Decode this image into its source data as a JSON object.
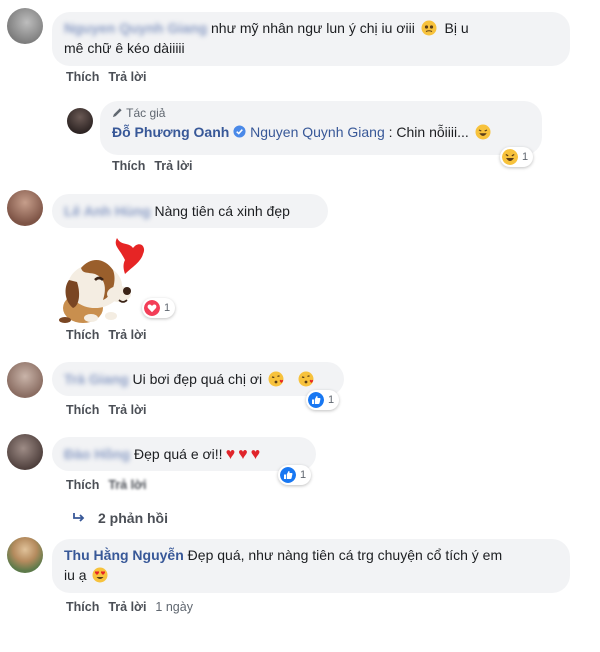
{
  "actions": {
    "like": "Thích",
    "reply": "Trả lời"
  },
  "comments": {
    "c1": {
      "name": "Nguyen Quynh Giang",
      "text": "như mỹ nhân ngư lun ý chị iu ơiii",
      "text2": "Bị u",
      "text3": "mê chữ ê kéo dàiiiii"
    },
    "c2": {
      "badge": "Tác giả",
      "name": "Đỗ Phương Oanh",
      "tag": "Nguyen Quynh Giang",
      "text": ": Chin nỗiiii...",
      "reaction_count": "1"
    },
    "c3": {
      "name": "Lê Anh Hùng",
      "text": "Nàng tiên cá xinh đẹp",
      "reaction_count": "1"
    },
    "c4": {
      "name": "Trà Giang",
      "text": "Ui bơi đẹp quá chị ơi",
      "reaction_count": "1"
    },
    "c5": {
      "name": "Đào Hồng",
      "text": "Đẹp quá e ơi!!",
      "reaction_count": "1"
    },
    "c6": {
      "name": "Thu Hằng Nguyễn",
      "text": "Đẹp quá, như nàng tiên cá trg chuyện cổ tích ý em",
      "text2": "iu ạ",
      "time": "1 ngày"
    }
  },
  "replies_link": "2 phản hồi",
  "icons": [
    "pencil-icon",
    "verified-badge-icon",
    "laugh-reaction-icon",
    "love-reaction-icon",
    "like-reaction-icon",
    "reply-arrow-icon",
    "kiss-emoji-icon",
    "heart-eyes-emoji-icon",
    "puppy-sticker"
  ],
  "colors": {
    "name": "#385898",
    "bubble": "#f2f3f5",
    "like_blue": "#1877f2",
    "love_red": "#f33e58"
  }
}
